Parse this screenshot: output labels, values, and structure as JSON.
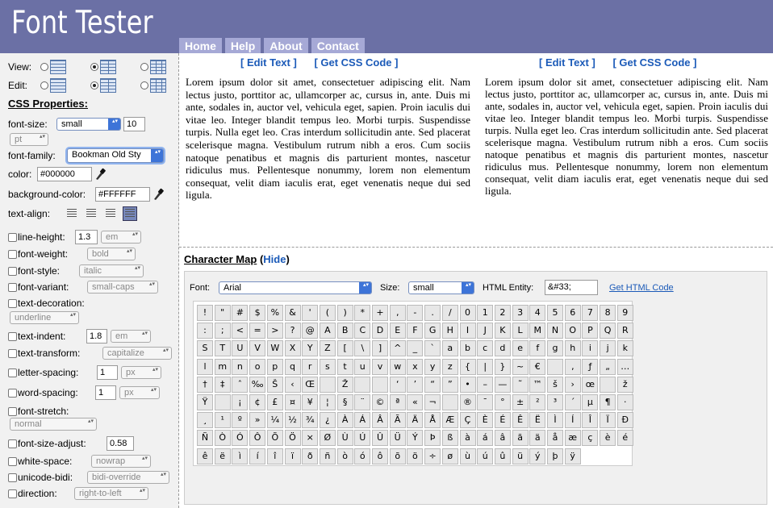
{
  "header": {
    "logo": "Font Tester"
  },
  "nav": [
    "Home",
    "Help",
    "About",
    "Contact"
  ],
  "sidebar": {
    "view_label": "View:",
    "edit_label": "Edit:",
    "css_title": "CSS Properties:",
    "font_size": {
      "label": "font-size:",
      "value": "small",
      "number": "10",
      "unit": "pt"
    },
    "font_family": {
      "label": "font-family:",
      "value": "Bookman Old Sty"
    },
    "color": {
      "label": "color:",
      "value": "#000000"
    },
    "background_color": {
      "label": "background-color:",
      "value": "#FFFFFF"
    },
    "text_align": {
      "label": "text-align:"
    },
    "line_height": {
      "label": "line-height:",
      "value": "1.3",
      "unit": "em"
    },
    "font_weight": {
      "label": "font-weight:",
      "value": "bold"
    },
    "font_style": {
      "label": "font-style:",
      "value": "italic"
    },
    "font_variant": {
      "label": "font-variant:",
      "value": "small-caps"
    },
    "text_decoration": {
      "label": "text-decoration:",
      "value": "underline"
    },
    "text_indent": {
      "label": "text-indent:",
      "value": "1.8",
      "unit": "em"
    },
    "text_transform": {
      "label": "text-transform:",
      "value": "capitalize"
    },
    "letter_spacing": {
      "label": "letter-spacing:",
      "value": "1",
      "unit": "px"
    },
    "word_spacing": {
      "label": "word-spacing:",
      "value": "1",
      "unit": "px"
    },
    "font_stretch": {
      "label": "font-stretch:",
      "value": "normal"
    },
    "font_size_adjust": {
      "label": "font-size-adjust:",
      "value": "0.58"
    },
    "white_space": {
      "label": "white-space:",
      "value": "nowrap"
    },
    "unicode_bidi": {
      "label": "unicode-bidi:",
      "value": "bidi-override"
    },
    "direction": {
      "label": "direction:",
      "value": "right-to-left"
    }
  },
  "preview": {
    "edit_text": "[ Edit Text ]",
    "get_css": "[ Get CSS Code ]",
    "sample": "Lorem ipsum dolor sit amet, consectetuer adipiscing elit. Nam lectus justo, porttitor ac, ullamcorper ac, cursus in, ante. Duis mi ante, sodales in, auctor vel, vehicula eget, sapien. Proin iaculis dui vitae leo. Integer blandit tempus leo. Morbi turpis. Suspendisse turpis. Nulla eget leo. Cras interdum sollicitudin ante. Sed placerat scelerisque magna. Vestibulum rutrum nibh a eros. Cum sociis natoque penatibus et magnis dis parturient montes, nascetur ridiculus mus. Pellentesque nonummy, lorem non elementum consequat, velit diam iaculis erat, eget venenatis neque dui sed ligula."
  },
  "charmap": {
    "title": "Character Map",
    "hide": "Hide",
    "font_label": "Font:",
    "font_value": "Arial",
    "size_label": "Size:",
    "size_value": "small",
    "entity_label": "HTML Entity:",
    "entity_value": "&#33;",
    "get_html": "Get HTML Code",
    "rows": [
      [
        "!",
        "\"",
        "#",
        "$",
        "%",
        "&",
        "'",
        "(",
        ")",
        "*",
        "+",
        ",",
        "-",
        ".",
        "/",
        "0",
        "1",
        "2",
        "3",
        "4",
        "5",
        "6",
        "7",
        "8",
        "9"
      ],
      [
        ":",
        ";",
        "<",
        "=",
        ">",
        "?",
        "@",
        "A",
        "B",
        "C",
        "D",
        "E",
        "F",
        "G",
        "H",
        "I",
        "J",
        "K",
        "L",
        "M",
        "N",
        "O",
        "P",
        "Q",
        "R"
      ],
      [
        "S",
        "T",
        "U",
        "V",
        "W",
        "X",
        "Y",
        "Z",
        "[",
        "\\",
        "]",
        "^",
        "_",
        "`",
        "a",
        "b",
        "c",
        "d",
        "e",
        "f",
        "g",
        "h",
        "i",
        "j",
        "k"
      ],
      [
        "l",
        "m",
        "n",
        "o",
        "p",
        "q",
        "r",
        "s",
        "t",
        "u",
        "v",
        "w",
        "x",
        "y",
        "z",
        "{",
        "|",
        "}",
        "~",
        "€",
        "",
        "‚",
        "ƒ",
        "„",
        "…"
      ],
      [
        "†",
        "‡",
        "ˆ",
        "‰",
        "Š",
        "‹",
        "Œ",
        "",
        "Ž",
        "",
        "",
        "‘",
        "’",
        "“",
        "”",
        "•",
        "–",
        "—",
        "˜",
        "™",
        "š",
        "›",
        "œ",
        "",
        "ž"
      ],
      [
        "Ÿ",
        "",
        "¡",
        "¢",
        "£",
        "¤",
        "¥",
        "¦",
        "§",
        "¨",
        "©",
        "ª",
        "«",
        "¬",
        "",
        "®",
        "¯",
        "°",
        "±",
        "²",
        "³",
        "´",
        "µ",
        "¶",
        "·"
      ],
      [
        "¸",
        "¹",
        "º",
        "»",
        "¼",
        "½",
        "¾",
        "¿",
        "À",
        "Á",
        "Â",
        "Ã",
        "Ä",
        "Å",
        "Æ",
        "Ç",
        "È",
        "É",
        "Ê",
        "Ë",
        "Ì",
        "Í",
        "Î",
        "Ï",
        "Ð"
      ],
      [
        "Ñ",
        "Ò",
        "Ó",
        "Ô",
        "Õ",
        "Ö",
        "×",
        "Ø",
        "Ù",
        "Ú",
        "Û",
        "Ü",
        "Ý",
        "Þ",
        "ß",
        "à",
        "á",
        "â",
        "ã",
        "ä",
        "å",
        "æ",
        "ç",
        "è",
        "é"
      ],
      [
        "ê",
        "ë",
        "ì",
        "í",
        "î",
        "ï",
        "ð",
        "ñ",
        "ò",
        "ó",
        "ô",
        "õ",
        "ö",
        "÷",
        "ø",
        "ù",
        "ú",
        "û",
        "ü",
        "ý",
        "þ",
        "ÿ"
      ]
    ]
  },
  "colors": {
    "header_bg": "#6b70a5",
    "tab_bg": "#a6a9d6",
    "link": "#1b5ab8",
    "sidebar_bg": "#f1f1f1"
  }
}
